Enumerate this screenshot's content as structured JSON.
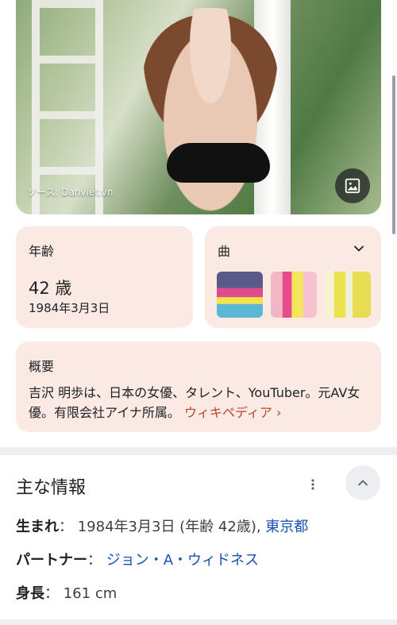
{
  "hero": {
    "caption": "ソース: Danviet.vn",
    "image_button_icon": "image-icon"
  },
  "age_card": {
    "title": "年齢",
    "value": "42 歳",
    "date": "1984年3月3日"
  },
  "songs_card": {
    "title": "曲",
    "expand_icon": "chevron-down-icon"
  },
  "overview_card": {
    "title": "概要",
    "text": "吉沢 明歩は、日本の女優、タレント、YouTuber。元AV女優。有限会社アイナ所属。",
    "link": "ウィキペディア ›"
  },
  "main_info": {
    "title": "主な情報",
    "rows": [
      {
        "label": "生まれ",
        "value": "1984年3月3日 (年齢 42歳), ",
        "link": "東京都"
      },
      {
        "label": "パートナー",
        "value": "",
        "link": "ジョン・A・ウィドネス"
      },
      {
        "label": "身長",
        "value": "161 cm",
        "link": ""
      }
    ]
  },
  "colors": {
    "card_bg": "#fbe9e4",
    "link_blue": "#1a4fb5",
    "wiki_orange": "#b7462b"
  }
}
